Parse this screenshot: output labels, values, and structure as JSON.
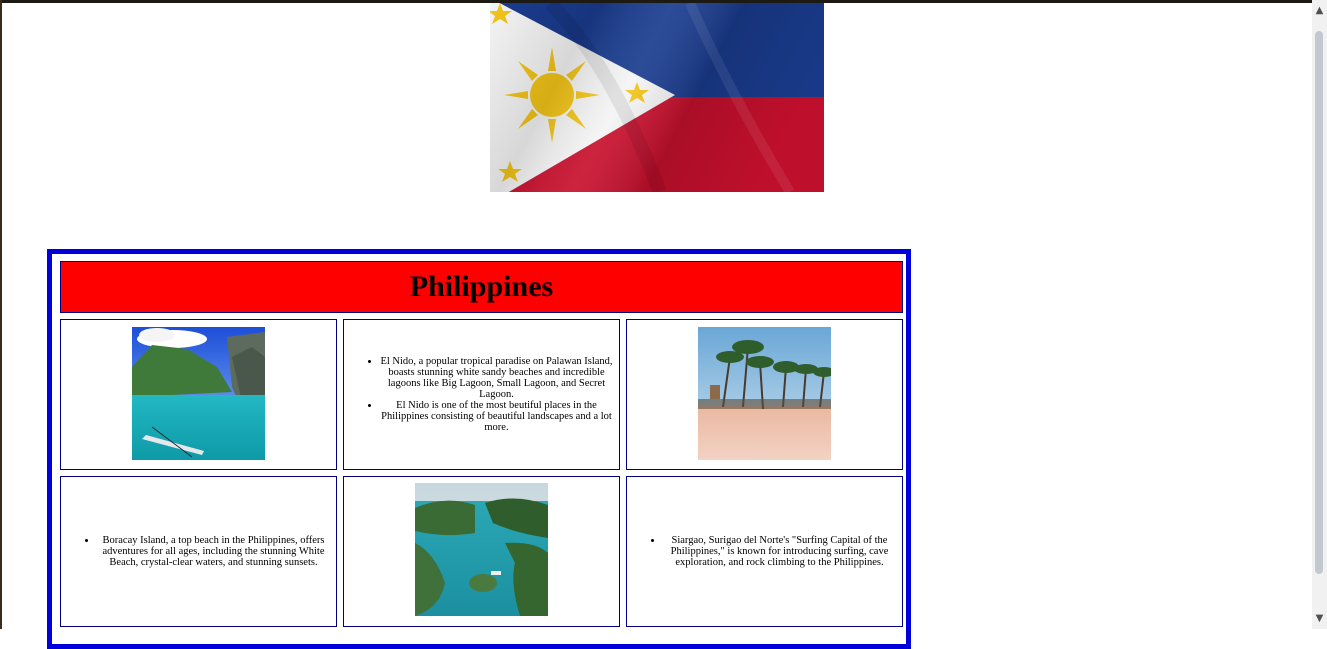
{
  "page": {
    "title": "Philippines"
  },
  "flag": {
    "name": "philippine-flag",
    "colors": {
      "blue": "#1a3c8f",
      "red": "#c8102e",
      "white": "#f4f4f4",
      "sun": "#f2c418"
    }
  },
  "table": {
    "border_color": "#0000dd",
    "header_bg": "#ff0000"
  },
  "cells": {
    "el_nido_points": [
      "El Nido, a popular tropical paradise on Palawan Island, boasts stunning white sandy beaches and incredible lagoons like Big Lagoon, Small Lagoon, and Secret Lagoon.",
      "El Nido is one of the most beutiful places in the Philippines consisting of beautiful landscapes and a lot more."
    ],
    "boracay_points": [
      "Boracay Island, a top beach in the Philippines, offers adventures for all ages, including the stunning White Beach, crystal-clear waters, and stunning sunsets."
    ],
    "siargao_points": [
      "Siargao, Surigao del Norte's \"Surfing Capital of the Philippines,\" is known for introducing surfing, cave exploration, and rock climbing to the Philippines."
    ]
  },
  "icons": {
    "scroll_up": "chevron-up-icon",
    "scroll_down": "chevron-down-icon"
  }
}
